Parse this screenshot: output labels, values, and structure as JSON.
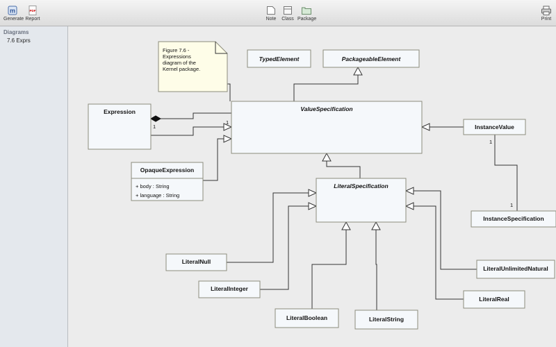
{
  "toolbar": {
    "generate_label": "Generate",
    "report_label": "Report",
    "note_label": "Note",
    "class_label": "Class",
    "package_label": "Package",
    "print_label": "Print",
    "report_icon_text": "PDF",
    "generate_icon_text": "m"
  },
  "sidebar": {
    "header": "Diagrams",
    "items": [
      {
        "label": "7.6 Exprs"
      }
    ]
  },
  "diagram": {
    "note_lines": [
      "Figure 7.6 -",
      "Expressions",
      "diagram of the",
      "Kernel package."
    ],
    "classes": {
      "typed_element": "TypedElement",
      "packageable_element": "PackageableElement",
      "value_specification": "ValueSpecification",
      "expression": "Expression",
      "opaque_expression": "OpaqueExpression",
      "opaque_attr_body": "+ body : String",
      "opaque_attr_language": "+ language : String",
      "instance_value": "InstanceValue",
      "literal_specification": "LiteralSpecification",
      "instance_specification": "InstanceSpecification",
      "literal_null": "LiteralNull",
      "literal_integer": "LiteralInteger",
      "literal_boolean": "LiteralBoolean",
      "literal_string": "LiteralString",
      "literal_real": "LiteralReal",
      "literal_unlimited_natural": "LiteralUnlimitedNatural"
    },
    "multiplicities": {
      "expr_operand_1": "1",
      "expr_operand_2": "1",
      "instance_value_end": "1",
      "instance_spec_end": "1"
    }
  }
}
